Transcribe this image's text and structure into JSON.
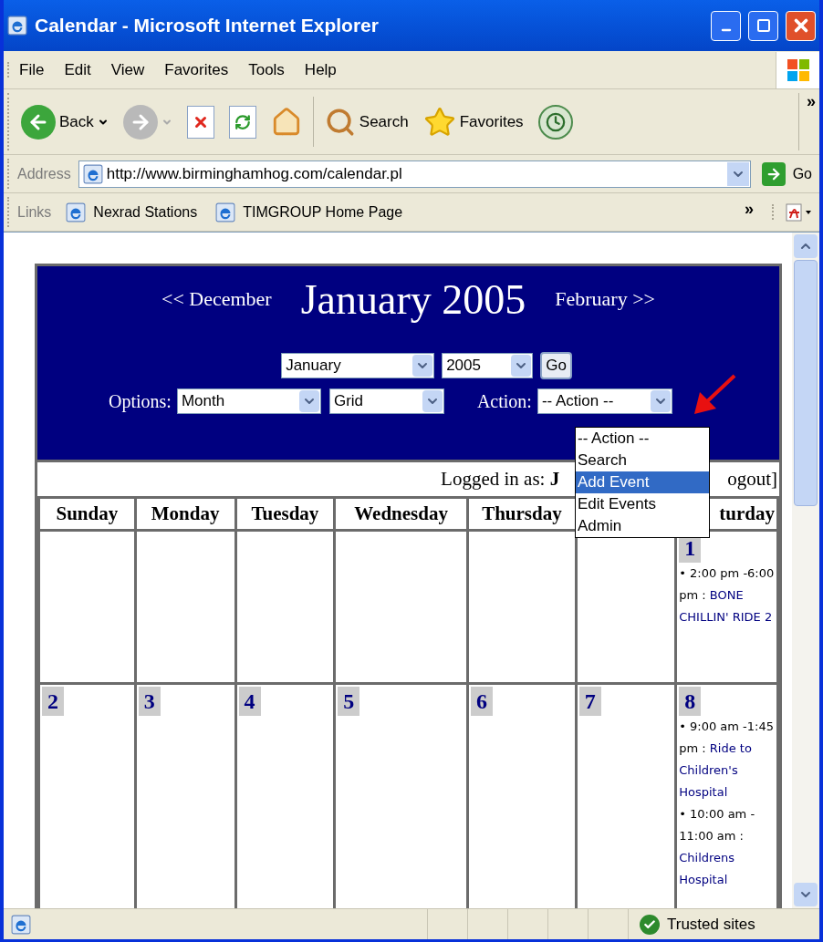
{
  "window": {
    "title": "Calendar - Microsoft Internet Explorer"
  },
  "menu": [
    "File",
    "Edit",
    "View",
    "Favorites",
    "Tools",
    "Help"
  ],
  "toolbar": [
    {
      "kind": "back",
      "label": "Back",
      "disabled": false
    },
    {
      "kind": "forward",
      "disabled": true
    },
    {
      "kind": "stop",
      "disabled": false
    },
    {
      "kind": "refresh",
      "disabled": false
    },
    {
      "kind": "home",
      "disabled": false
    },
    {
      "kind": "search",
      "label": "Search",
      "disabled": false
    },
    {
      "kind": "favorites",
      "label": "Favorites",
      "disabled": false
    },
    {
      "kind": "history",
      "disabled": false
    }
  ],
  "toolbar_overflow": "»",
  "address": {
    "label": "Address",
    "value": "http://www.birminghamhog.com/calendar.pl",
    "go": "Go"
  },
  "links": {
    "label": "Links",
    "items": [
      "Nexrad Stations",
      "TIMGROUP Home Page"
    ],
    "overflow": "»"
  },
  "calendar": {
    "prev": "<< December",
    "title": "January 2005",
    "next": "February >>",
    "month_select": "January",
    "year_select": "2005",
    "go": "Go",
    "options_label": "Options:",
    "view_select": "Month",
    "layout_select": "Grid",
    "action_label": "Action:",
    "action_select": "-- Action --",
    "action_menu": [
      {
        "label": "-- Action --",
        "selected": false
      },
      {
        "label": "Search",
        "selected": false
      },
      {
        "label": "Add Event",
        "selected": true
      },
      {
        "label": "Edit Events",
        "selected": false
      },
      {
        "label": "Admin",
        "selected": false
      }
    ],
    "logged_in": "Logged in as: **J**",
    "logout": "ogout]",
    "day_headers": [
      "Sunday",
      "Monday",
      "Tuesday",
      "Wednesday",
      "Thursday"
    ],
    "last_header": "turday",
    "weeks": [
      {
        "cells": [
          {},
          {},
          {},
          {},
          {},
          {},
          {
            "day": "1",
            "events": [
              {
                "time": "• 2:00 pm -6:00 pm : ",
                "title": "BONE CHILLIN' RIDE 2"
              }
            ]
          }
        ]
      },
      {
        "cells": [
          {
            "day": "2"
          },
          {
            "day": "3"
          },
          {
            "day": "4"
          },
          {
            "day": "5"
          },
          {
            "day": "6"
          },
          {
            "day": "7"
          },
          {
            "day": "8",
            "events": [
              {
                "time": "• 9:00 am -1:45 pm : ",
                "title": "Ride to Children's Hospital"
              },
              {
                "time": "• 10:00 am - 11:00 am : ",
                "title": "Childrens Hospital"
              }
            ]
          }
        ]
      }
    ]
  },
  "status": {
    "zone": "Trusted sites"
  }
}
